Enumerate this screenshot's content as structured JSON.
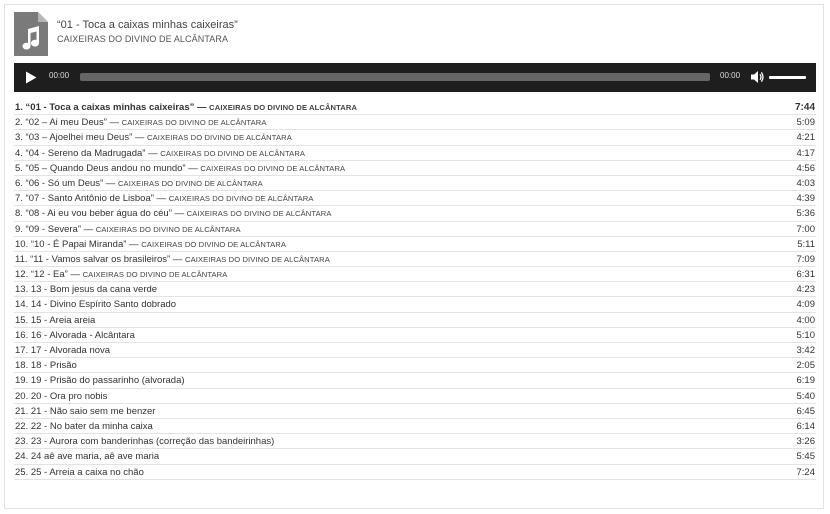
{
  "header": {
    "title": "“01 - Toca a caixas minhas caixeiras”",
    "artist": "CAIXEIRAS DO DIVINO DE ALCÂNTARA"
  },
  "player": {
    "current_time": "00:00",
    "duration": "00:00",
    "progress": 0,
    "volume": 1.0
  },
  "tracks": [
    {
      "name": "1. “01 - Toca a caixas minhas caixeiras”",
      "artist": "CAIXEIRAS DO DIVINO DE ALCÂNTARA",
      "duration": "7:44",
      "active": true
    },
    {
      "name": "2. “02 – Ai meu Deus”",
      "artist": "CAIXEIRAS DO DIVINO DE ALCÂNTARA",
      "duration": "5:09"
    },
    {
      "name": "3. “03 – Ajoelhei meu Deus”",
      "artist": "CAIXEIRAS DO DIVINO DE ALCÂNTARA",
      "duration": "4:21"
    },
    {
      "name": "4. “04 - Sereno da Madrugada”",
      "artist": "CAIXEIRAS DO DIVINO DE ALCÂNTARA",
      "duration": "4:17"
    },
    {
      "name": "5. “05 – Quando Deus andou no mundo”",
      "artist": "CAIXEIRAS DO DIVINO DE ALCÂNTARA",
      "duration": "4:56"
    },
    {
      "name": "6. “06 - Só um Deus”",
      "artist": "CAIXEIRAS DO DIVINO DE ALCÂNTARA",
      "duration": "4:03"
    },
    {
      "name": "7. “07 - Santo Antônio de Lisboa”",
      "artist": "CAIXEIRAS DO DIVINO DE ALCÂNTARA",
      "duration": "4:39"
    },
    {
      "name": "8. “08 - Ai eu vou beber água do céu”",
      "artist": "CAIXEIRAS DO DIVINO DE ALCÂNTARA",
      "duration": "5:36"
    },
    {
      "name": "9. “09 - Severa”",
      "artist": "CAIXEIRAS DO DIVINO DE ALCÂNTARA",
      "duration": "7:00"
    },
    {
      "name": "10. “10 - É Papai Miranda”",
      "artist": "CAIXEIRAS DO DIVINO DE ALCÂNTARA",
      "duration": "5:11"
    },
    {
      "name": "11. “11 - Vamos salvar os brasileiros”",
      "artist": "CAIXEIRAS DO DIVINO DE ALCÂNTARA",
      "duration": "7:09"
    },
    {
      "name": "12. “12 - Ea”",
      "artist": "CAIXEIRAS DO DIVINO DE ALCÂNTARA",
      "duration": "6:31"
    },
    {
      "name": "13. 13 - Bom jesus da cana verde",
      "artist": "",
      "duration": "4:23"
    },
    {
      "name": "14. 14 - Divino Espírito Santo dobrado",
      "artist": "",
      "duration": "4:09"
    },
    {
      "name": "15. 15 - Areia areia",
      "artist": "",
      "duration": "4:00"
    },
    {
      "name": "16. 16 - Alvorada - Alcântara",
      "artist": "",
      "duration": "5:10"
    },
    {
      "name": "17. 17 - Alvorada nova",
      "artist": "",
      "duration": "3:42"
    },
    {
      "name": "18. 18 - Prisão",
      "artist": "",
      "duration": "2:05"
    },
    {
      "name": "19. 19 - Prisão do passarinho (alvorada)",
      "artist": "",
      "duration": "6:19"
    },
    {
      "name": "20. 20 - Ora pro nobis",
      "artist": "",
      "duration": "5:40"
    },
    {
      "name": "21. 21 - Não saio sem me benzer",
      "artist": "",
      "duration": "6:45"
    },
    {
      "name": "22. 22 - No bater da minha caixa",
      "artist": "",
      "duration": "6:14"
    },
    {
      "name": "23. 23 - Aurora com banderinhas (correção das bandeirinhas)",
      "artist": "",
      "duration": "3:26"
    },
    {
      "name": "24. 24 aê ave maria, aê ave maria",
      "artist": "",
      "duration": "5:45"
    },
    {
      "name": "25. 25 - Arreia a caixa no chão",
      "artist": "",
      "duration": "7:24"
    }
  ]
}
